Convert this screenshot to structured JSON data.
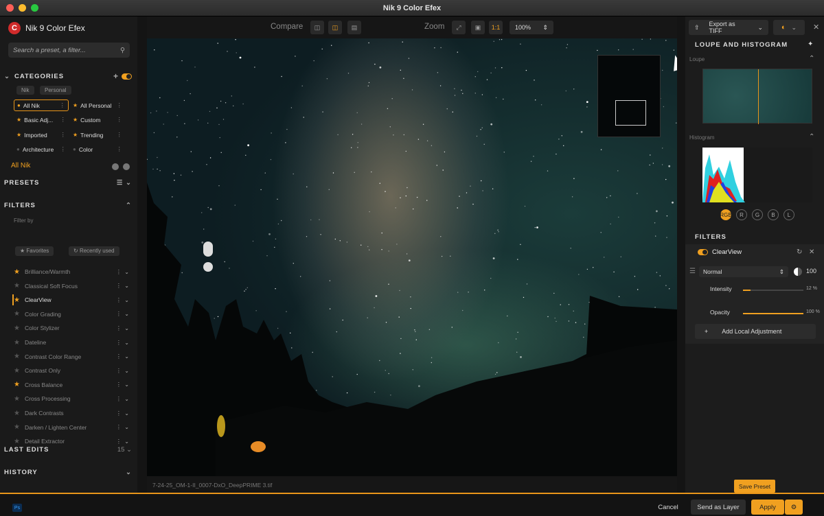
{
  "window": {
    "title": "Nik 9 Color Efex",
    "traffic_lights": [
      "#fe5f57",
      "#febc2e",
      "#28c840"
    ]
  },
  "app": {
    "name": "Nik 9 Color Efex",
    "brand_color": "#d02b2b",
    "accent": "#f0a020"
  },
  "search": {
    "placeholder": "Search a preset, a filter..."
  },
  "categories": {
    "title": "CATEGORIES",
    "chips": [
      "Nik",
      "Personal"
    ],
    "items": [
      "All Nik",
      "All Personal",
      "Basic Adj...",
      "Custom",
      "Imported",
      "Trending",
      "Architecture",
      "Color"
    ],
    "current": "All Nik"
  },
  "presets": {
    "title": "PRESETS"
  },
  "filters": {
    "title": "FILTERS",
    "filter_by": "Filter by",
    "chips": [
      "Favorites",
      "Recently used"
    ],
    "items": [
      {
        "label": "Brilliance/Warmth",
        "fav": true
      },
      {
        "label": "Classical Soft Focus",
        "fav": false
      },
      {
        "label": "ClearView",
        "fav": true
      },
      {
        "label": "Color Grading",
        "fav": false
      },
      {
        "label": "Color Stylizer",
        "fav": false
      },
      {
        "label": "Dateline",
        "fav": false
      },
      {
        "label": "Contrast Color Range",
        "fav": false
      },
      {
        "label": "Contrast Only",
        "fav": false
      },
      {
        "label": "Cross Balance",
        "fav": true
      },
      {
        "label": "Cross Processing",
        "fav": false
      },
      {
        "label": "Dark Contrasts",
        "fav": false
      },
      {
        "label": "Darken / Lighten Center",
        "fav": false
      },
      {
        "label": "Detail Extractor",
        "fav": false
      }
    ]
  },
  "last_edits": {
    "title": "LAST EDITS",
    "count": "15"
  },
  "history": {
    "title": "HISTORY"
  },
  "toolbar": {
    "compare_label": "Compare",
    "zoom_label": "Zoom",
    "zoom_one": "1:1",
    "zoom_value": "100%"
  },
  "canvas": {
    "file_path": "7-24-25_OM-1-II_0007-DxO_DeepPRIME 3.tif"
  },
  "right": {
    "export_label": "Export as TIFF",
    "loupe_histogram_title": "LOUPE AND HISTOGRAM",
    "loupe_label": "Loupe",
    "histogram_label": "Histogram",
    "channels": [
      "RGB",
      "R",
      "G",
      "B",
      "L"
    ],
    "filters_title": "FILTERS",
    "active_filter": "ClearView",
    "blend_mode": "Normal",
    "opacity_value": "100",
    "intensity_label": "Intensity",
    "intensity_value": "12 %",
    "intensity_level": 0.12,
    "opacity_label": "Opacity",
    "opacity_pct": "100 %",
    "opacity_level": 1.0,
    "add_local": "Add Local Adjustment",
    "save_preset": "Save Preset"
  },
  "bottom": {
    "ps_label": "Ps",
    "cancel": "Cancel",
    "send_as_layer": "Send as Layer",
    "apply": "Apply"
  }
}
